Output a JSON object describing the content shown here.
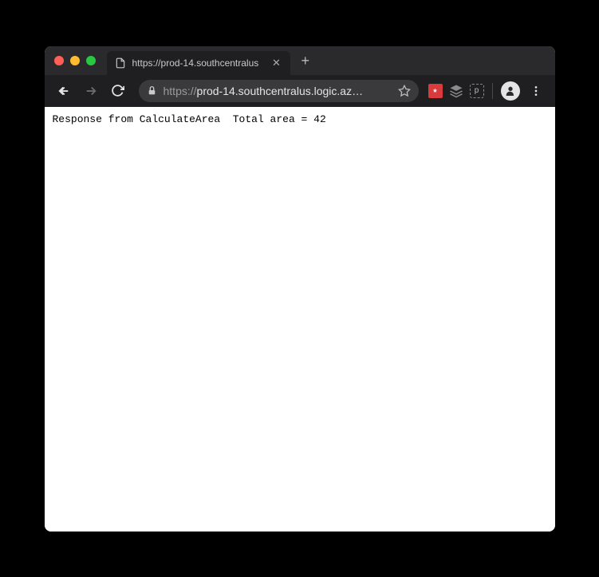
{
  "window": {
    "tab_title": "https://prod-14.southcentralus",
    "url_protocol": "https://",
    "url_display": "prod-14.southcentralus.logic.az…"
  },
  "page": {
    "body_text": "Response from CalculateArea  Total area = 42"
  },
  "extensions": {
    "a_label": "⋆",
    "b_label": "≋",
    "c_label": "p"
  }
}
